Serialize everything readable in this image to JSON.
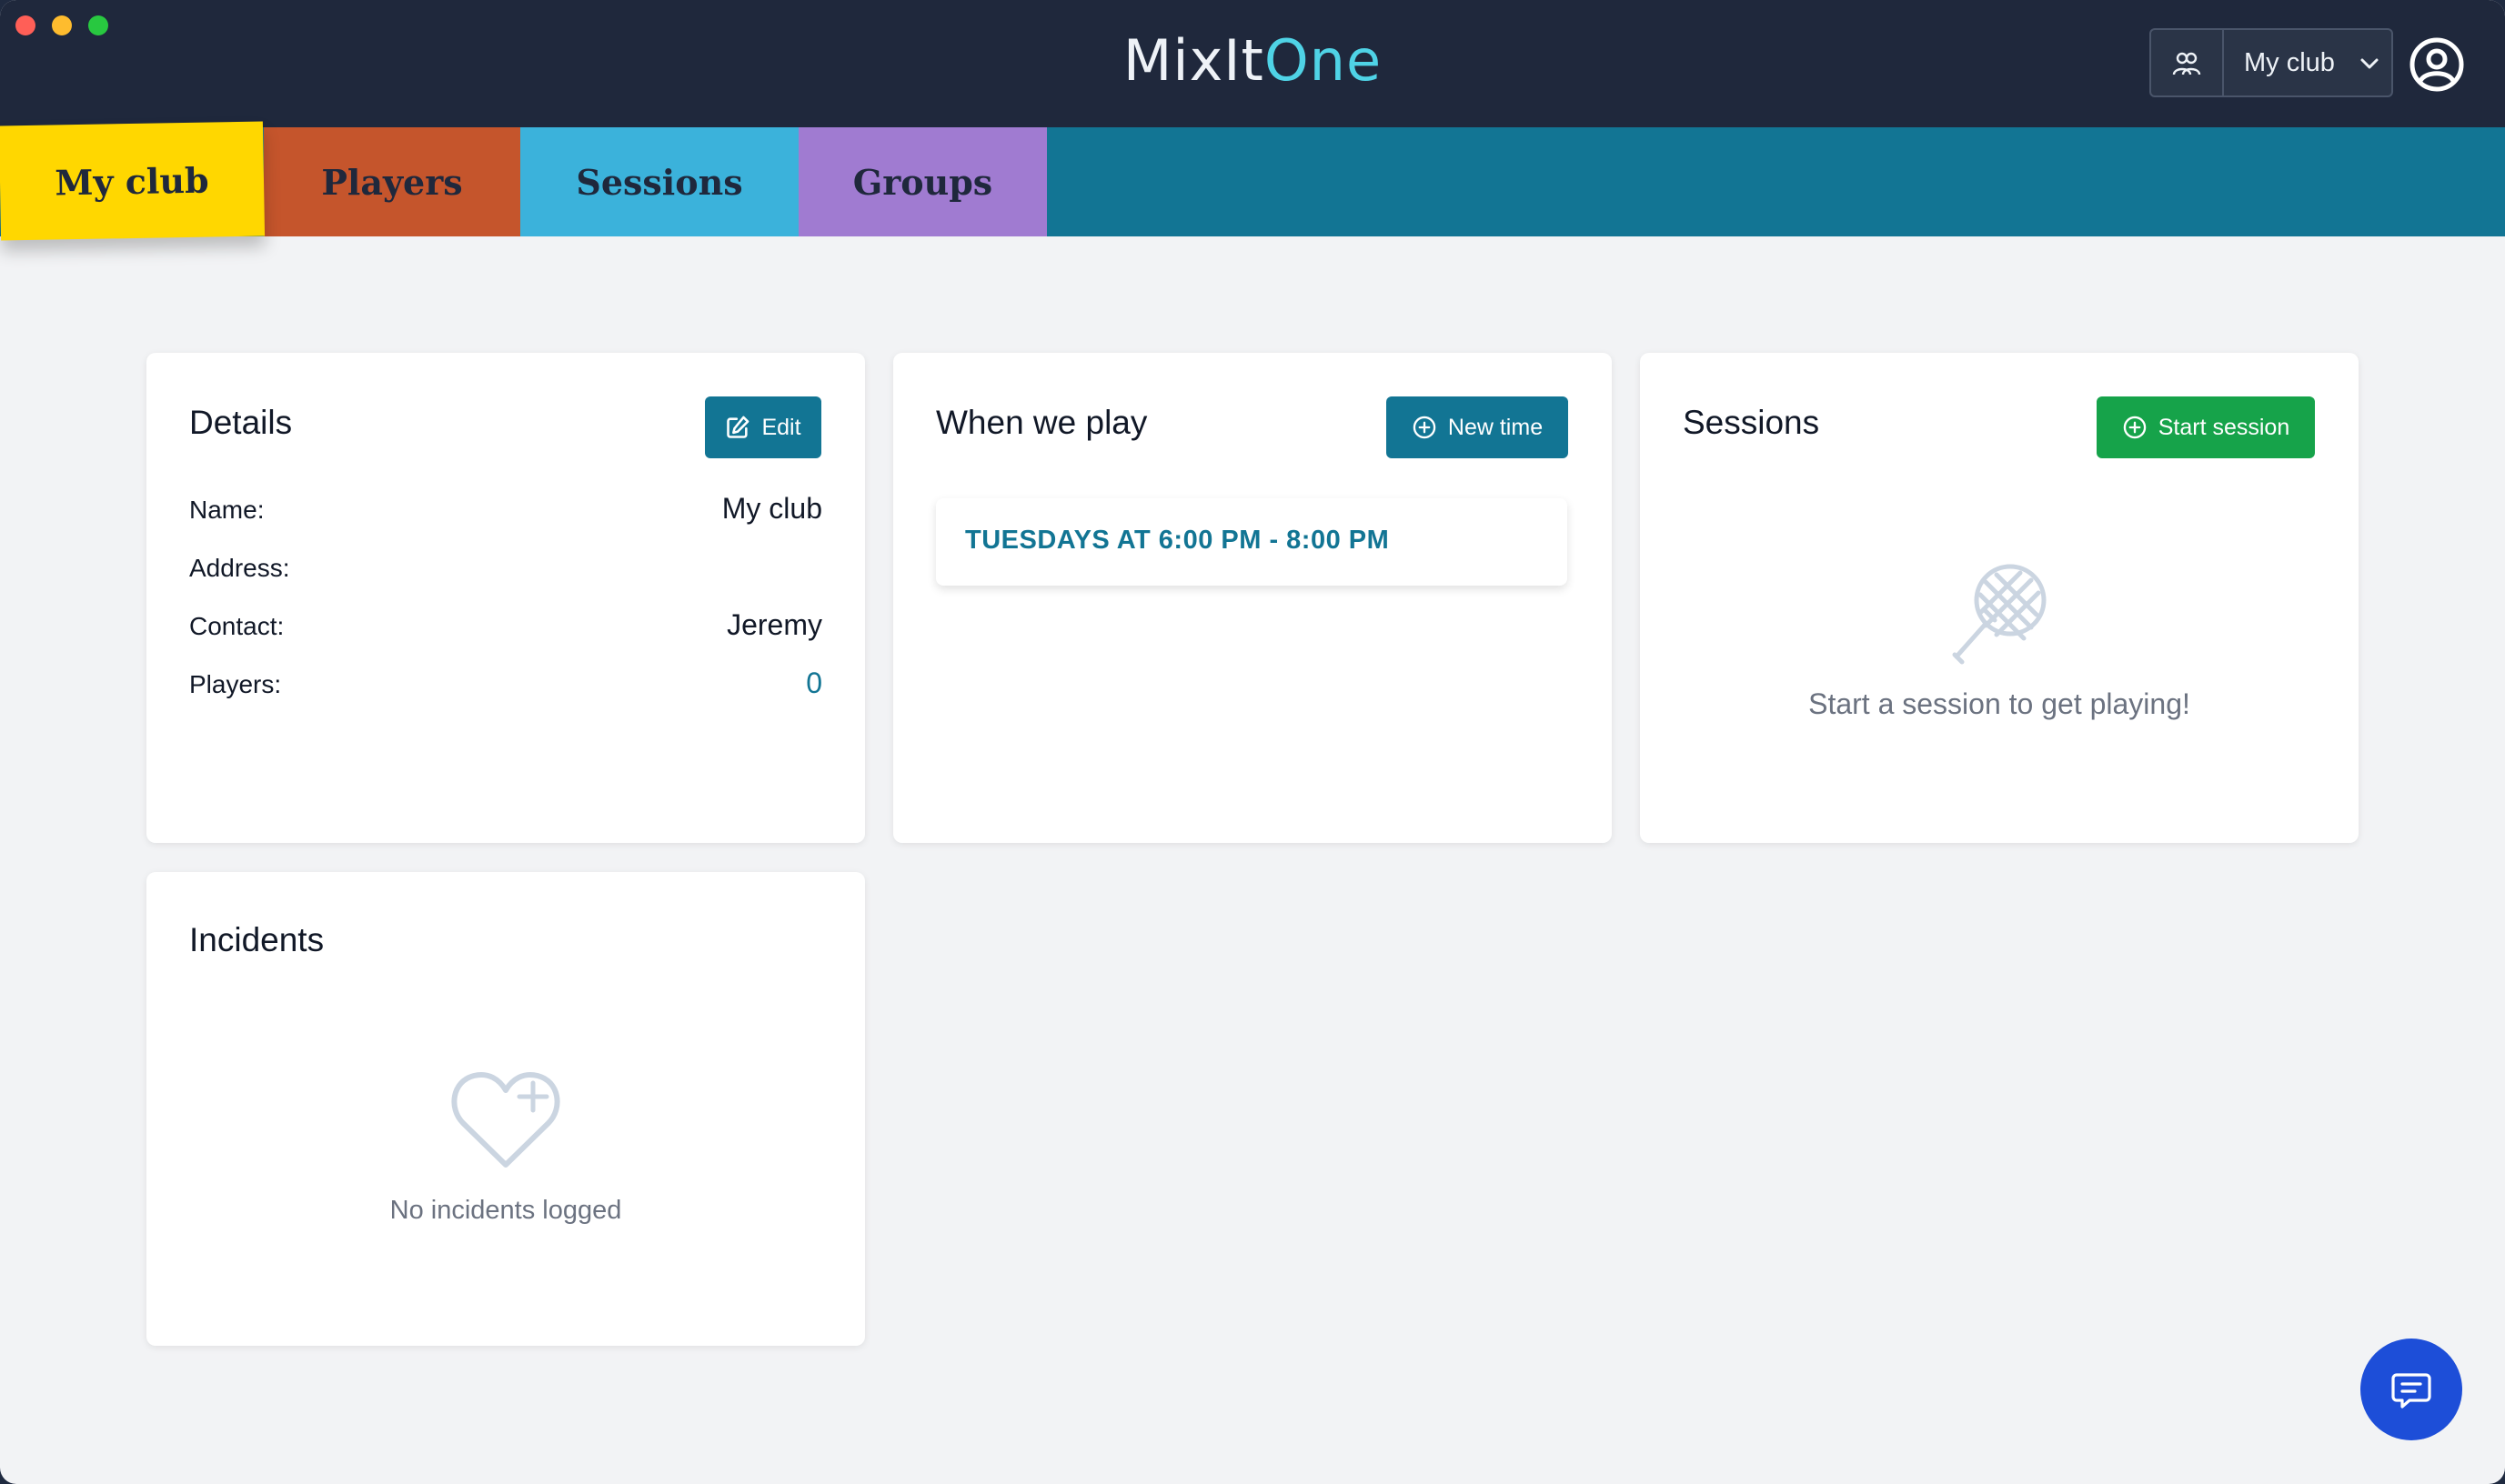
{
  "app": {
    "brand_main": "MixIt",
    "brand_accent": "One",
    "club_selector_label": "My club"
  },
  "tabs": [
    {
      "label": "My club",
      "color": "#ffd700",
      "active": true
    },
    {
      "label": "Players",
      "color": "#c5552c"
    },
    {
      "label": "Sessions",
      "color": "#3bb2db"
    },
    {
      "label": "Groups",
      "color": "#a07bd1"
    }
  ],
  "details": {
    "title": "Details",
    "edit_label": "Edit",
    "fields": [
      {
        "label": "Name:",
        "value": "My club"
      },
      {
        "label": "Address:",
        "value": ""
      },
      {
        "label": "Contact:",
        "value": "Jeremy"
      },
      {
        "label": "Players:",
        "value": "0"
      }
    ]
  },
  "when_we_play": {
    "title": "When we play",
    "new_time_label": "New time",
    "times": [
      "TUESDAYS AT 6:00 PM - 8:00 PM"
    ]
  },
  "sessions": {
    "title": "Sessions",
    "start_label": "Start session",
    "empty_message": "Start a session to get playing!",
    "empty_icon": "tennis-racket-icon"
  },
  "incidents": {
    "title": "Incidents",
    "empty_message": "No incidents logged",
    "empty_icon": "heart-plus-icon"
  },
  "colors": {
    "primary": "#127594",
    "success": "#16a34a",
    "header": "#1f283c",
    "brand_accent": "#4fd3e6",
    "chat": "#1d4ed8"
  }
}
